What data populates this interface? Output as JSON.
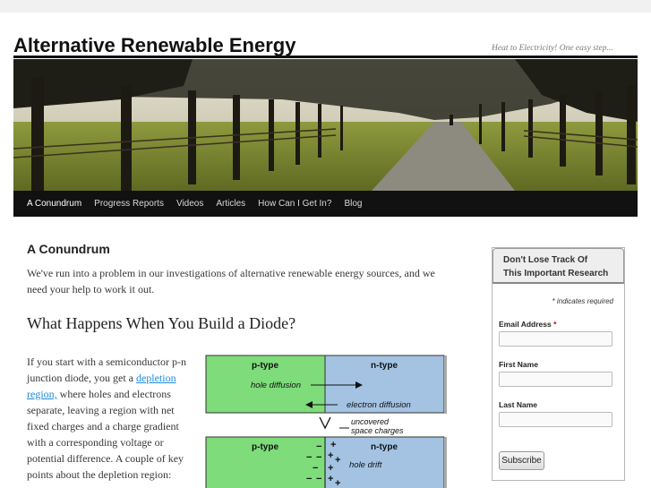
{
  "site": {
    "title": "Alternative Renewable Energy",
    "tagline": "Heat to Electricity! One easy step..."
  },
  "nav": {
    "items": [
      {
        "label": "A Conundrum",
        "active": true
      },
      {
        "label": "Progress Reports"
      },
      {
        "label": "Videos"
      },
      {
        "label": "Articles"
      },
      {
        "label": "How Can I Get In?"
      },
      {
        "label": "Blog"
      }
    ]
  },
  "post": {
    "title": "A Conundrum",
    "intro": "We've run into a problem in our investigations of alternative renewable energy sources, and we need your help to work it out.",
    "heading": "What Happens When You Build a Diode?",
    "body_pre": "If you start with a semiconductor p-n junction diode, you get a ",
    "body_link": "depletion region,",
    "body_post": " where holes and electrons separate, leaving a region with net fixed charges and a charge gradient with a corresponding voltage or potential difference.  A couple of key points about the depletion region:"
  },
  "diagram": {
    "p_type": "p-type",
    "n_type": "n-type",
    "hole_diffusion": "hole diffusion",
    "electron_diffusion": "electron diffusion",
    "uncovered_line1": "uncovered",
    "uncovered_line2": "space charges",
    "hole_drift": "hole drift",
    "colors": {
      "p": "#7edc7a",
      "n": "#a4c3e2"
    }
  },
  "sidebar": {
    "heading_line1": "Don't Lose Track Of",
    "heading_line2": "This Important Research",
    "required_note": "* indicates required",
    "email_label": "Email Address ",
    "required_mark": "*",
    "first_name_label": "First Name",
    "last_name_label": "Last Name",
    "subscribe_label": "Subscribe"
  }
}
